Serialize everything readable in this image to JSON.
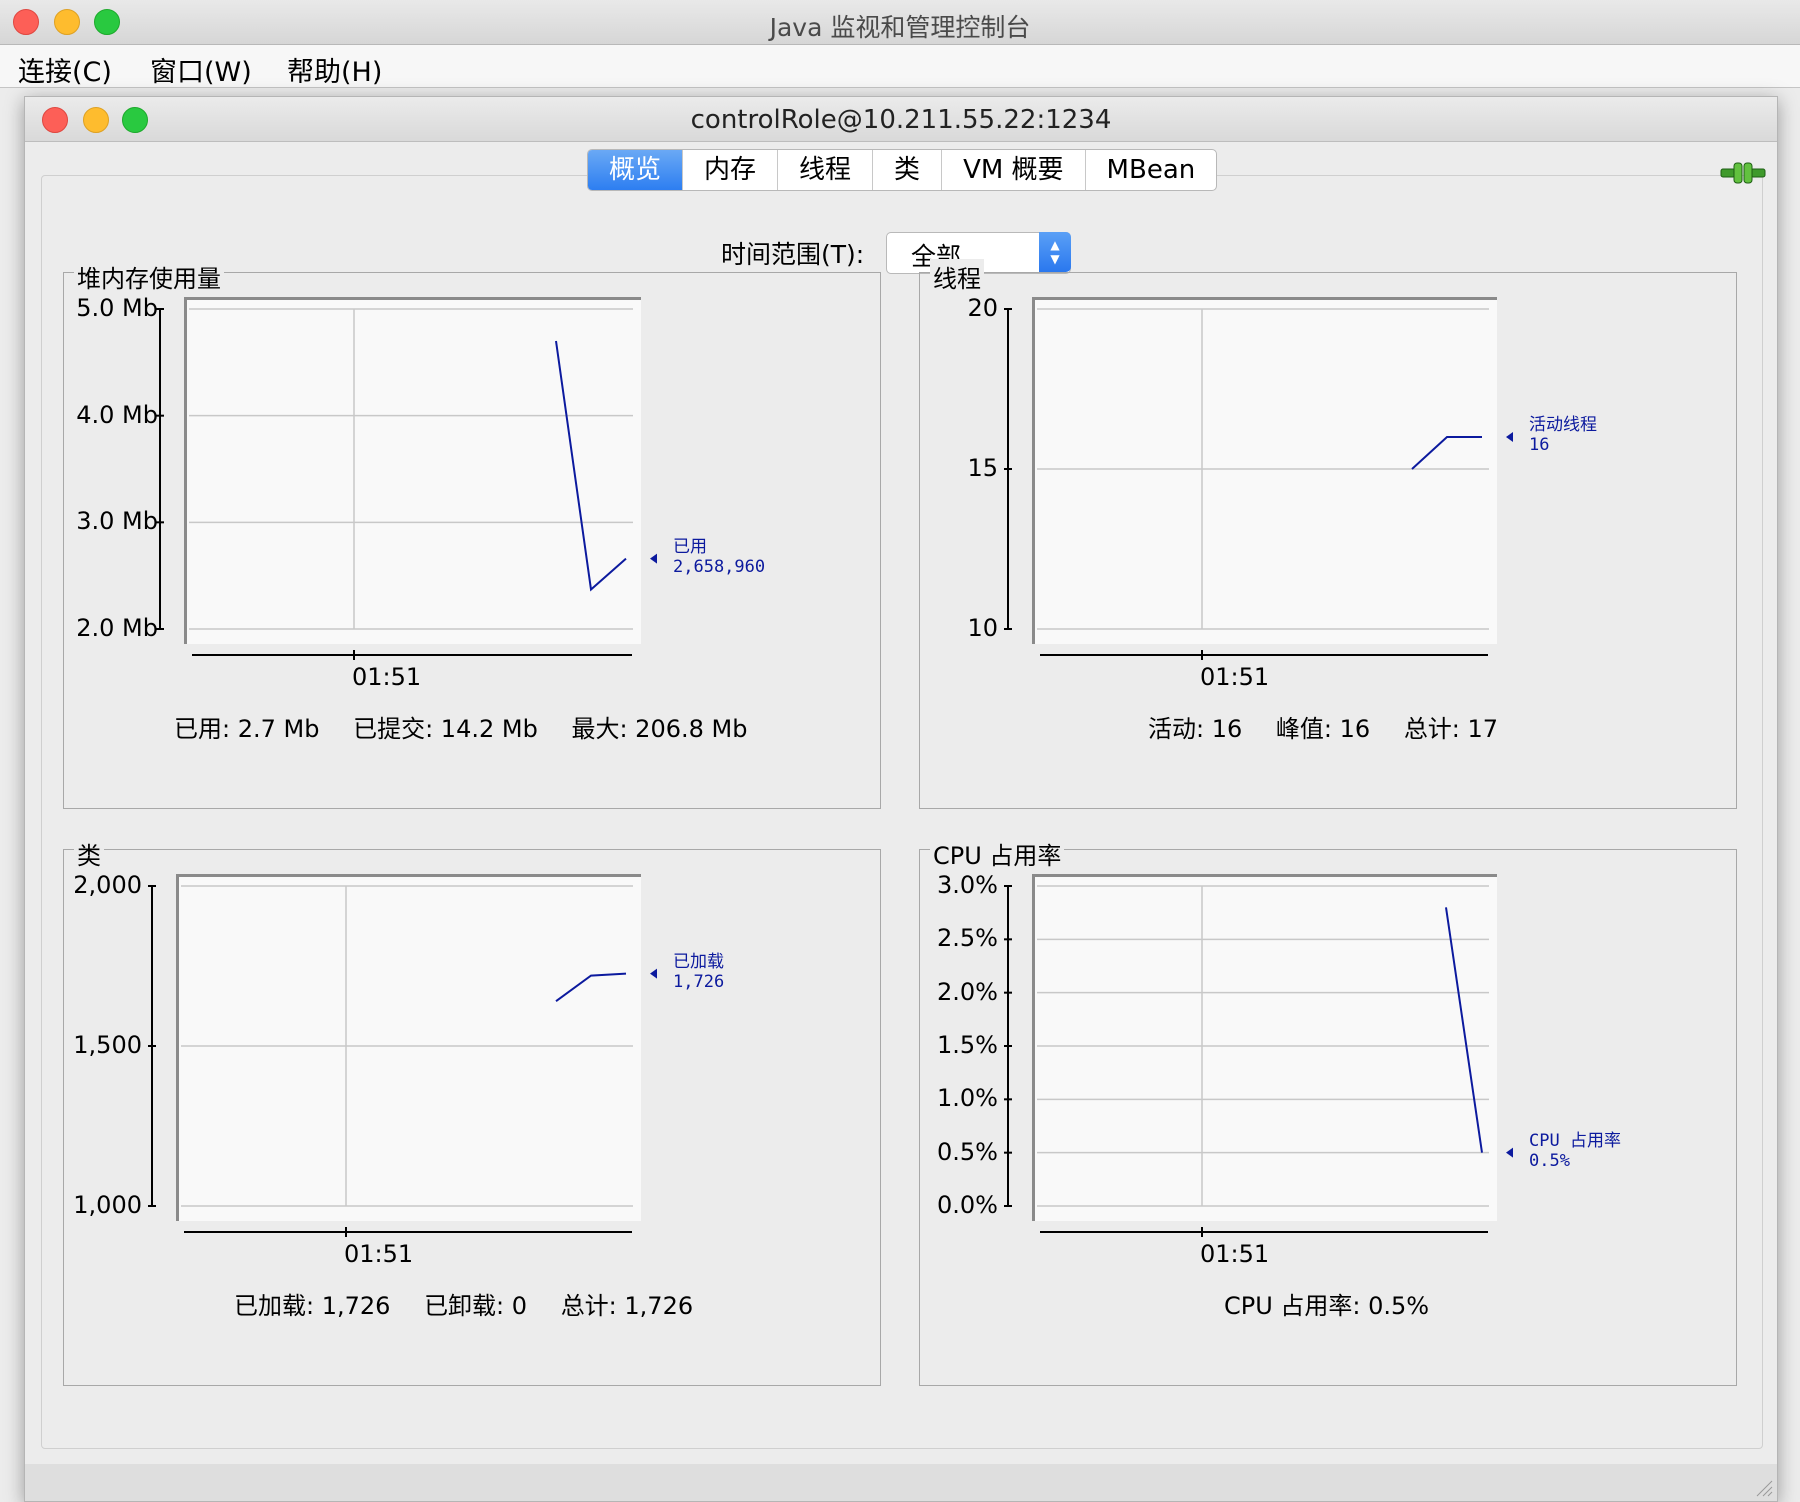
{
  "app": {
    "title": "Java 监视和管理控制台"
  },
  "menu": {
    "items": [
      "连接(C)",
      "窗口(W)",
      "帮助(H)"
    ]
  },
  "connection": {
    "title": "controlRole@10.211.55.22:1234",
    "status_icon": "connected-plug-icon"
  },
  "tabs": [
    {
      "label": "概览",
      "active": true
    },
    {
      "label": "内存",
      "active": false
    },
    {
      "label": "线程",
      "active": false
    },
    {
      "label": "类",
      "active": false
    },
    {
      "label": "VM 概要",
      "active": false
    },
    {
      "label": "MBean",
      "active": false
    }
  ],
  "time_range": {
    "label": "时间范围(T):",
    "value": "全部"
  },
  "colors": {
    "series": "#0c1a9e",
    "active_tab": "#2d7ef1",
    "grid": "#c8c8c8"
  },
  "panels": {
    "heap": {
      "title": "堆内存使用量",
      "summary": {
        "used": "已用: 2.7 Mb",
        "committed": "已提交: 14.2 Mb",
        "max": "最大: 206.8 Mb"
      }
    },
    "threads": {
      "title": "线程",
      "summary": {
        "live": "活动: 16",
        "peak": "峰值: 16",
        "total": "总计: 17"
      }
    },
    "classes": {
      "title": "类",
      "summary": {
        "loaded": "已加载: 1,726",
        "unloaded": "已卸载: 0",
        "total": "总计: 1,726"
      }
    },
    "cpu": {
      "title": "CPU 占用率",
      "summary": {
        "usage": "CPU 占用率: 0.5%"
      }
    }
  },
  "chart_data": [
    {
      "id": "heap",
      "type": "line",
      "title": "堆内存使用量",
      "y_ticks": [
        "5.0 Mb",
        "4.0 Mb",
        "3.0 Mb",
        "2.0 Mb"
      ],
      "ylim": [
        2.0,
        5.0
      ],
      "x_ticks": [
        "01:51"
      ],
      "series": [
        {
          "name": "已用",
          "value_label": "2,658,960",
          "values": [
            4.7,
            2.37,
            2.66
          ]
        }
      ]
    },
    {
      "id": "threads",
      "type": "line",
      "title": "线程",
      "y_ticks": [
        "20",
        "15",
        "10"
      ],
      "ylim": [
        10,
        20
      ],
      "x_ticks": [
        "01:51"
      ],
      "series": [
        {
          "name": "活动线程",
          "value_label": "16",
          "values": [
            15,
            16,
            16
          ]
        }
      ]
    },
    {
      "id": "classes",
      "type": "line",
      "title": "类",
      "y_ticks": [
        "2,000",
        "1,500",
        "1,000"
      ],
      "ylim": [
        1000,
        2000
      ],
      "x_ticks": [
        "01:51"
      ],
      "series": [
        {
          "name": "已加载",
          "value_label": "1,726",
          "values": [
            1640,
            1720,
            1726
          ]
        }
      ]
    },
    {
      "id": "cpu",
      "type": "line",
      "title": "CPU 占用率",
      "y_ticks": [
        "3.0%",
        "2.5%",
        "2.0%",
        "1.5%",
        "1.0%",
        "0.5%",
        "0.0%"
      ],
      "ylim": [
        0,
        3.0
      ],
      "x_ticks": [
        "01:51"
      ],
      "series": [
        {
          "name": "CPU 占用率",
          "value_label": "0.5%",
          "values": [
            2.8,
            0.5
          ]
        }
      ]
    }
  ]
}
